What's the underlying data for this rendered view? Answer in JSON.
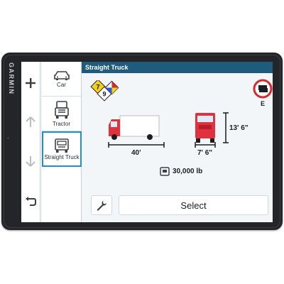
{
  "device": {
    "brand": "GARMIN"
  },
  "leftbar": {
    "items": [
      {
        "icon": "plus-icon",
        "state": "active"
      },
      {
        "icon": "arrow-up-icon",
        "state": "disabled"
      },
      {
        "icon": "arrow-down-icon",
        "state": "disabled"
      },
      {
        "icon": "back-icon",
        "state": "active"
      }
    ]
  },
  "vehicles": {
    "items": [
      {
        "label": "Car",
        "icon": "car-icon"
      },
      {
        "label": "Tractor",
        "icon": "tractor-icon"
      },
      {
        "label": "Straight Truck",
        "icon": "straight-truck-icon",
        "selected": true
      }
    ]
  },
  "header": {
    "title": "Straight Truck"
  },
  "profile": {
    "hazmat_numbers": [
      "7",
      "9"
    ],
    "restriction_sign_label": "E",
    "length": "40'",
    "width": "7' 6\"",
    "height": "13' 6\"",
    "weight": "30,000 lb"
  },
  "actions": {
    "select_label": "Select",
    "tools_icon": "wrench-icon"
  },
  "colors": {
    "header_bg": "#1f5b7c",
    "selection": "#1c8fd6",
    "truck": "#e0323e",
    "sign_ring": "#d62b2b"
  }
}
